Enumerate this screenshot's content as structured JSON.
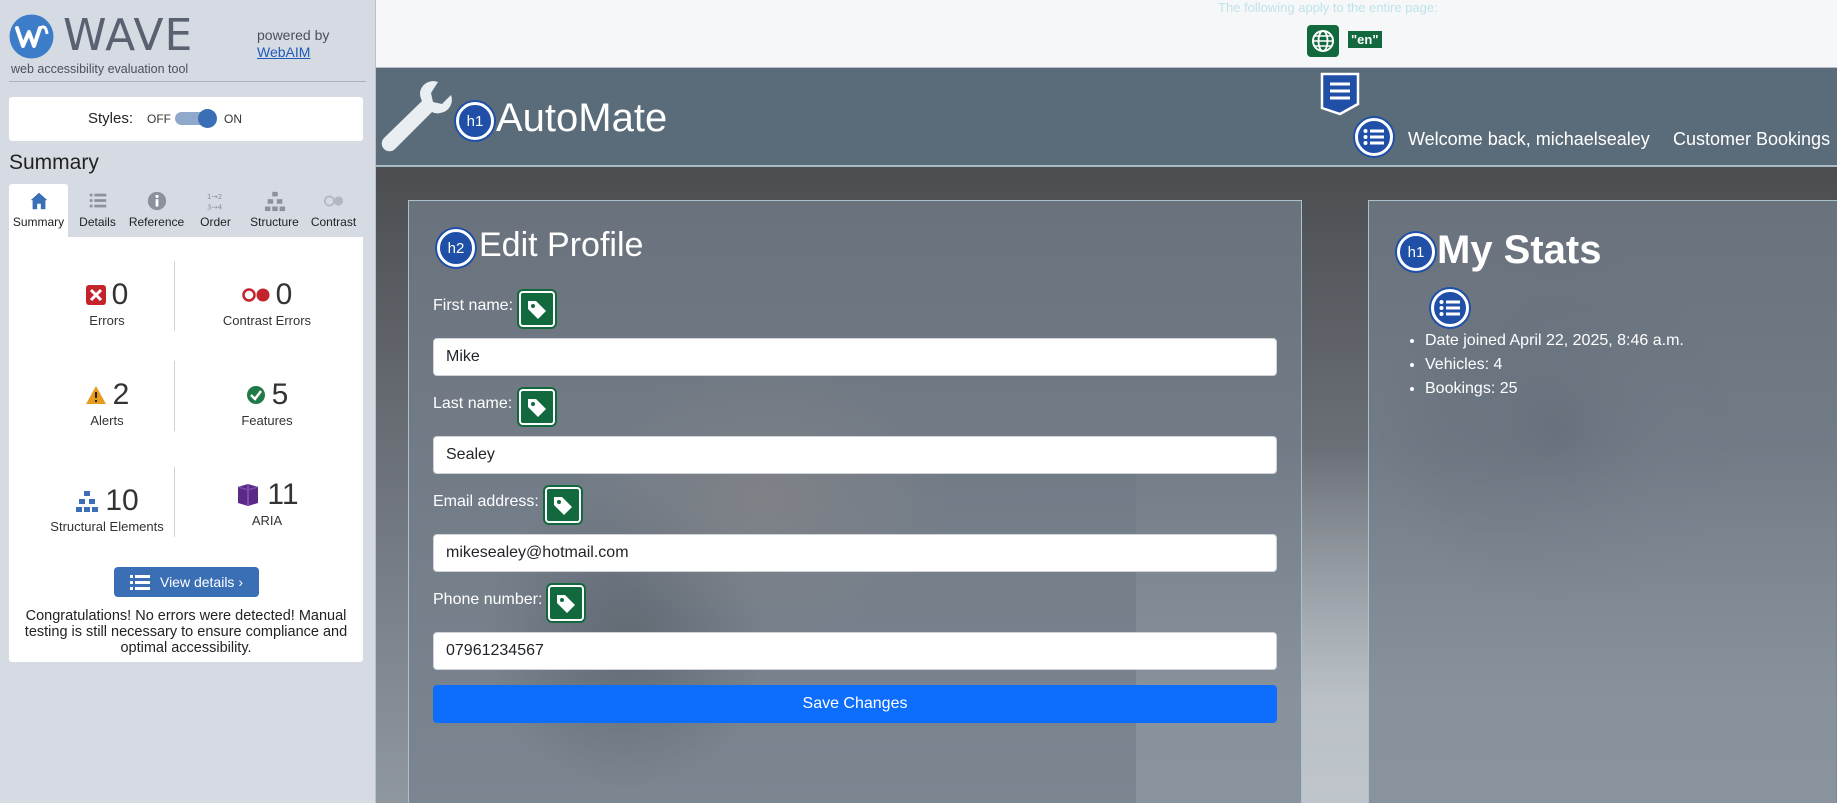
{
  "wave": {
    "logo_text": "WAVE",
    "tagline": "web accessibility evaluation tool",
    "powered_by": "powered by",
    "webaim_link": "WebAIM",
    "styles": {
      "label": "Styles:",
      "off": "OFF",
      "on": "ON",
      "state": "on"
    },
    "summary_heading": "Summary",
    "tabs": [
      {
        "label": "Summary",
        "icon": "home-icon",
        "active": true
      },
      {
        "label": "Details",
        "icon": "list-icon",
        "active": false
      },
      {
        "label": "Reference",
        "icon": "info-icon",
        "active": false
      },
      {
        "label": "Order",
        "icon": "order-icon",
        "active": false
      },
      {
        "label": "Structure",
        "icon": "structure-icon",
        "active": false
      },
      {
        "label": "Contrast",
        "icon": "contrast-icon",
        "active": false
      }
    ],
    "stats": {
      "errors": {
        "value": "0",
        "label": "Errors"
      },
      "contrast_errors": {
        "value": "0",
        "label": "Contrast Errors"
      },
      "alerts": {
        "value": "2",
        "label": "Alerts"
      },
      "features": {
        "value": "5",
        "label": "Features"
      },
      "structural": {
        "value": "10",
        "label": "Structural Elements"
      },
      "aria": {
        "value": "11",
        "label": "ARIA"
      }
    },
    "view_details": "View details ›",
    "congrats": "Congratulations! No errors were detected! Manual testing is still necessary to ensure compliance and optimal accessibility."
  },
  "page": {
    "notice": "The following apply to the entire page:",
    "lang_badge": "\"en\"",
    "header": {
      "brand_badge": "h1",
      "brand": "AutoMate",
      "welcome": "Welcome back, michaelsealey",
      "bookings": "Customer Bookings"
    },
    "profile": {
      "badge": "h2",
      "title": "Edit Profile",
      "fields": [
        {
          "label": "First name:",
          "value": "Mike"
        },
        {
          "label": "Last name:",
          "value": "Sealey"
        },
        {
          "label": "Email address:",
          "value": "mikesealey@hotmail.com"
        },
        {
          "label": "Phone number:",
          "value": "07961234567"
        }
      ],
      "save": "Save Changes"
    },
    "stats": {
      "badge": "h1",
      "title": "My Stats",
      "items": [
        "Date joined April 22, 2025, 8:46 a.m.",
        "Vehicles: 4",
        "Bookings: 25"
      ]
    }
  },
  "colors": {
    "wave_blue": "#3a6fb5",
    "feature_green": "#13693e",
    "heading_badge": "#1f4fa6",
    "header_bg": "#5a6c79",
    "save_button": "#0d6efd"
  }
}
